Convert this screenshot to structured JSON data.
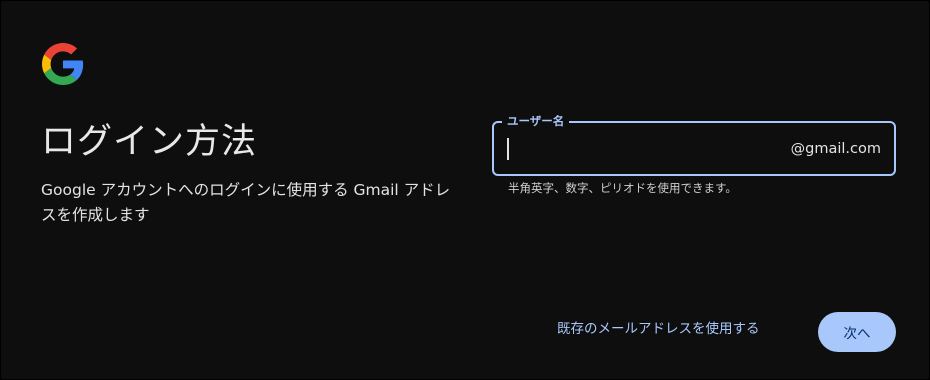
{
  "heading": "ログイン方法",
  "description": "Google アカウントへのログインに使用する Gmail アドレスを作成します",
  "username_field": {
    "label": "ユーザー名",
    "value": "",
    "suffix": "@gmail.com",
    "hint": "半角英字、数字、ピリオドを使用できます。"
  },
  "actions": {
    "alt_link": "既存のメールアドレスを使用する",
    "next_label": "次へ"
  },
  "colors": {
    "background": "#0e0e0f",
    "accent": "#a8c7fa",
    "button_text": "#062e6f",
    "text": "#e3e3e3"
  },
  "icons": {
    "logo": "google-g-logo-icon"
  }
}
